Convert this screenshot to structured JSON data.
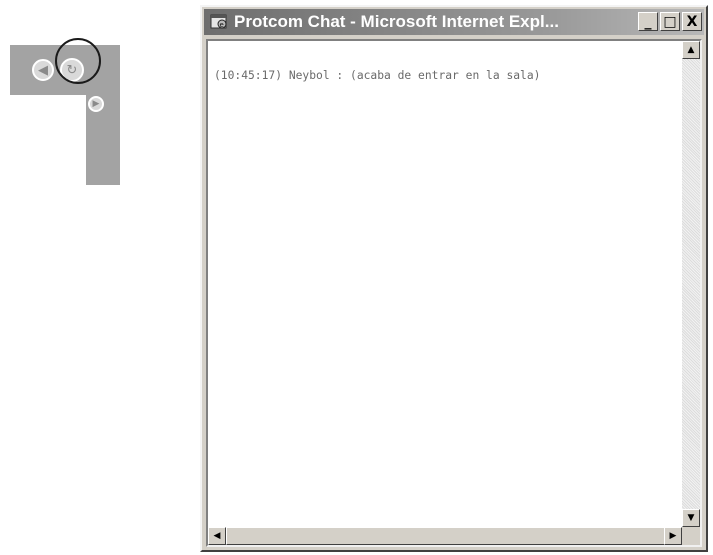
{
  "toolbar": {
    "buttons": [
      {
        "icon": "back-arrow-icon"
      },
      {
        "icon": "refresh-icon",
        "highlighted": true
      },
      {
        "icon": "forward-arrow-icon"
      }
    ]
  },
  "window": {
    "title": "Protcom Chat - Microsoft Internet Expl...",
    "icon": "internet-explorer-icon",
    "controls": {
      "minimize": "_",
      "maximize": "□",
      "close": "X"
    }
  },
  "chat": {
    "messages": [
      "(10:45:17) Neybol : (acaba de entrar en la sala)"
    ]
  },
  "scrollbars": {
    "up_arrow": "▲",
    "down_arrow": "▼",
    "left_arrow": "◀",
    "right_arrow": "▶"
  }
}
